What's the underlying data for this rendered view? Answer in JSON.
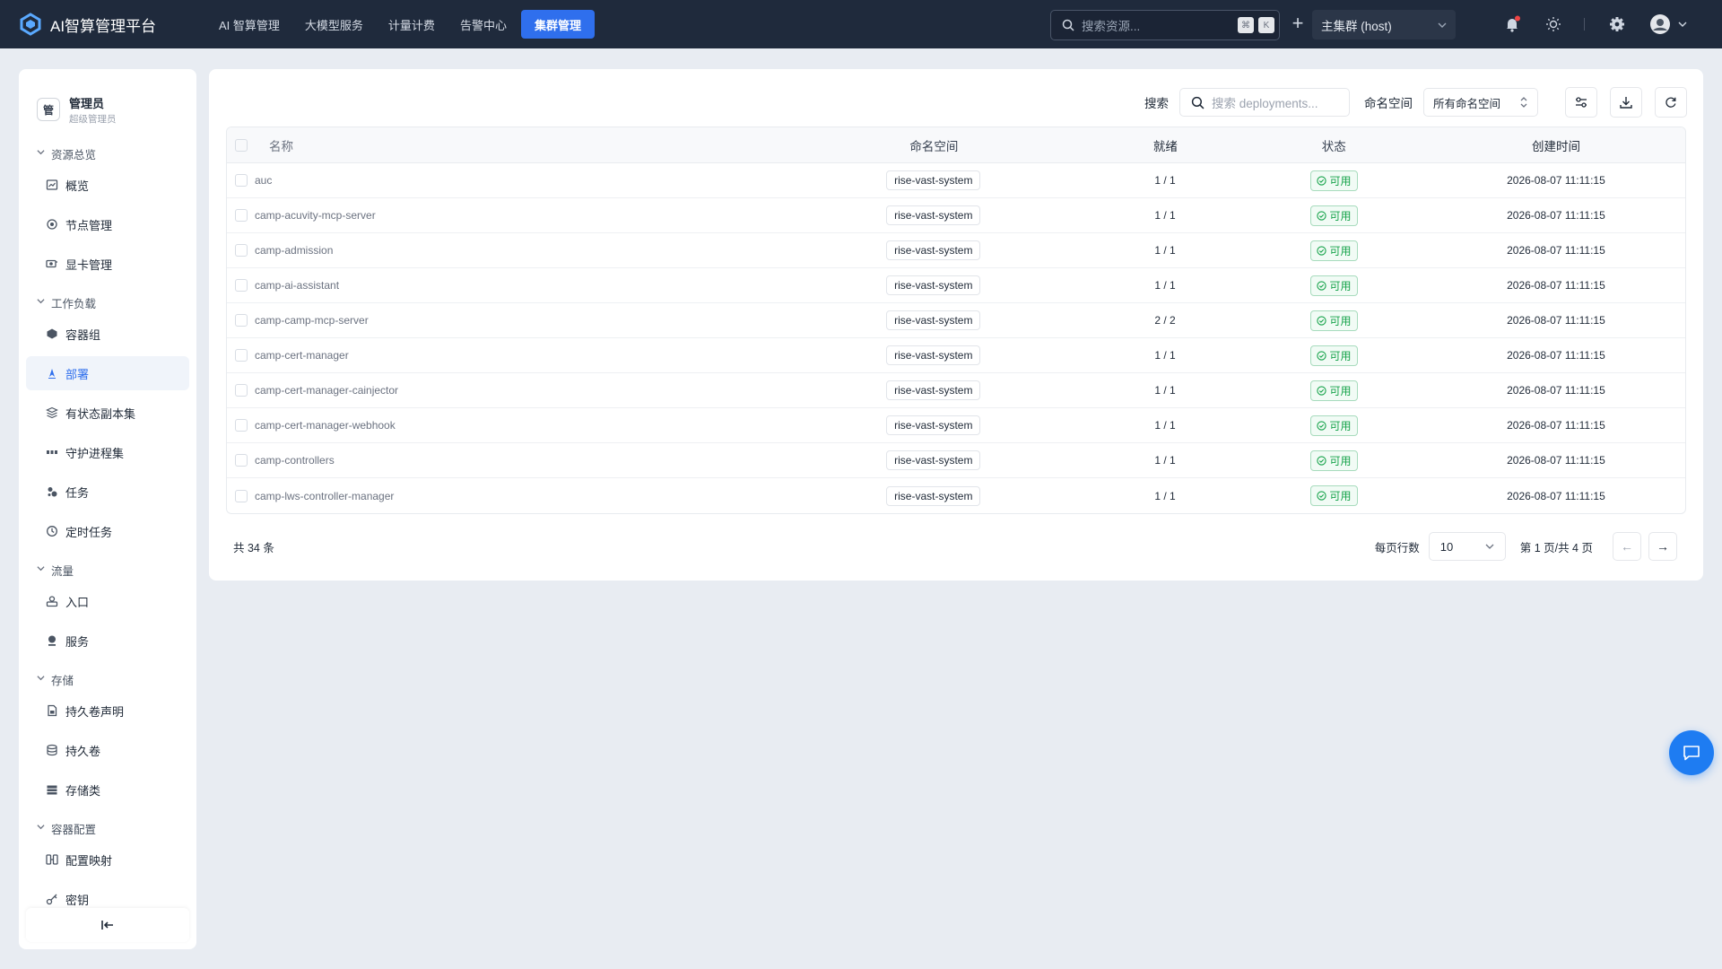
{
  "app": {
    "title": "AI智算管理平台"
  },
  "topnav": [
    {
      "label": "AI 智算管理",
      "active": false
    },
    {
      "label": "大模型服务",
      "active": false
    },
    {
      "label": "计量计费",
      "active": false
    },
    {
      "label": "告警中心",
      "active": false
    },
    {
      "label": "集群管理",
      "active": true
    }
  ],
  "global_search": {
    "placeholder": "搜索资源...",
    "kbd1": "⌘",
    "kbd2": "K"
  },
  "cluster": {
    "value": "主集群 (host)"
  },
  "user": {
    "avatar_text": "管",
    "name": "管理员",
    "role": "超级管理员"
  },
  "sidebar": {
    "sections": [
      {
        "title": "资源总览",
        "items": [
          {
            "label": "概览",
            "icon": "overview-icon"
          },
          {
            "label": "节点管理",
            "icon": "node-icon"
          },
          {
            "label": "显卡管理",
            "icon": "gpu-icon"
          }
        ]
      },
      {
        "title": "工作负载",
        "items": [
          {
            "label": "容器组",
            "icon": "pod-icon"
          },
          {
            "label": "部署",
            "icon": "deploy-icon",
            "active": true
          },
          {
            "label": "有状态副本集",
            "icon": "statefulset-icon"
          },
          {
            "label": "守护进程集",
            "icon": "daemonset-icon"
          },
          {
            "label": "任务",
            "icon": "job-icon"
          },
          {
            "label": "定时任务",
            "icon": "cronjob-icon"
          }
        ]
      },
      {
        "title": "流量",
        "items": [
          {
            "label": "入口",
            "icon": "ingress-icon"
          },
          {
            "label": "服务",
            "icon": "service-icon"
          }
        ]
      },
      {
        "title": "存储",
        "items": [
          {
            "label": "持久卷声明",
            "icon": "pvc-icon"
          },
          {
            "label": "持久卷",
            "icon": "pv-icon"
          },
          {
            "label": "存储类",
            "icon": "storageclass-icon"
          }
        ]
      },
      {
        "title": "容器配置",
        "items": [
          {
            "label": "配置映射",
            "icon": "configmap-icon"
          },
          {
            "label": "密钥",
            "icon": "secret-icon"
          }
        ]
      }
    ]
  },
  "toolbar": {
    "search_label": "搜索",
    "search_placeholder": "搜索 deployments...",
    "namespace_label": "命名空间",
    "namespace_value": "所有命名空间"
  },
  "table": {
    "columns": [
      "名称",
      "命名空间",
      "就绪",
      "状态",
      "创建时间"
    ],
    "rows": [
      {
        "name": "auc",
        "namespace": "rise-vast-system",
        "ready": "1 / 1",
        "status": "可用",
        "created": "2026-08-07 11:11:15"
      },
      {
        "name": "camp-acuvity-mcp-server",
        "namespace": "rise-vast-system",
        "ready": "1 / 1",
        "status": "可用",
        "created": "2026-08-07 11:11:15"
      },
      {
        "name": "camp-admission",
        "namespace": "rise-vast-system",
        "ready": "1 / 1",
        "status": "可用",
        "created": "2026-08-07 11:11:15"
      },
      {
        "name": "camp-ai-assistant",
        "namespace": "rise-vast-system",
        "ready": "1 / 1",
        "status": "可用",
        "created": "2026-08-07 11:11:15"
      },
      {
        "name": "camp-camp-mcp-server",
        "namespace": "rise-vast-system",
        "ready": "2 / 2",
        "status": "可用",
        "created": "2026-08-07 11:11:15"
      },
      {
        "name": "camp-cert-manager",
        "namespace": "rise-vast-system",
        "ready": "1 / 1",
        "status": "可用",
        "created": "2026-08-07 11:11:15"
      },
      {
        "name": "camp-cert-manager-cainjector",
        "namespace": "rise-vast-system",
        "ready": "1 / 1",
        "status": "可用",
        "created": "2026-08-07 11:11:15"
      },
      {
        "name": "camp-cert-manager-webhook",
        "namespace": "rise-vast-system",
        "ready": "1 / 1",
        "status": "可用",
        "created": "2026-08-07 11:11:15"
      },
      {
        "name": "camp-controllers",
        "namespace": "rise-vast-system",
        "ready": "1 / 1",
        "status": "可用",
        "created": "2026-08-07 11:11:15"
      },
      {
        "name": "camp-lws-controller-manager",
        "namespace": "rise-vast-system",
        "ready": "1 / 1",
        "status": "可用",
        "created": "2026-08-07 11:11:15"
      }
    ]
  },
  "pagination": {
    "total": "共 34 条",
    "page_size_label": "每页行数",
    "page_size": "10",
    "page_info": "第 1 页/共 4 页",
    "prev": "←",
    "next": "→"
  },
  "colors": {
    "accent": "#2f6fed",
    "topbar": "#1f2a3c",
    "success": "#16a34a",
    "notification_dot": "#ef4444"
  }
}
